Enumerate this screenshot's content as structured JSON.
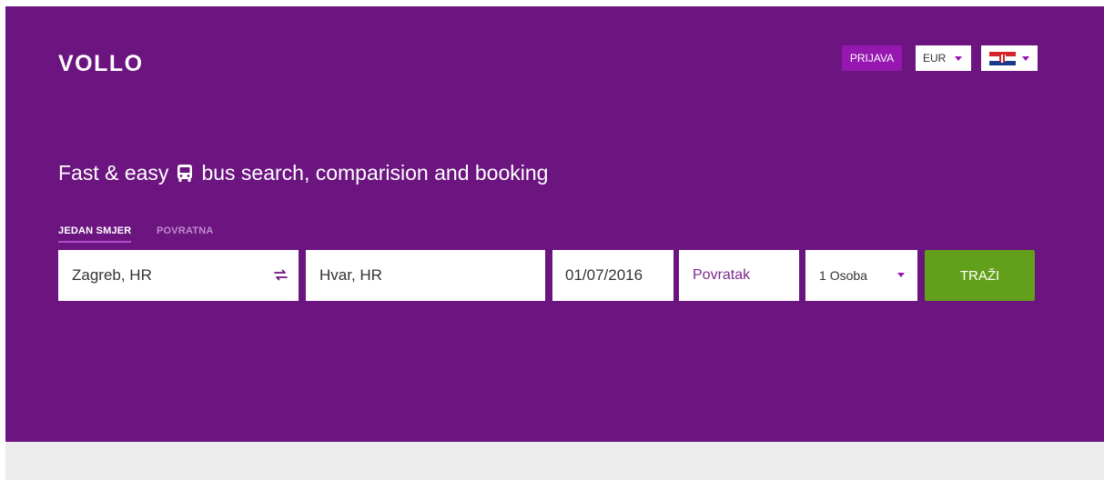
{
  "brand": {
    "logo": "VOLLO"
  },
  "header": {
    "login_label": "PRIJAVA",
    "currency": "EUR",
    "language_flag": "croatia-flag-icon"
  },
  "hero": {
    "tagline_before": "Fast & easy",
    "tagline_icon": "bus-icon",
    "tagline_after": "bus search, comparision and booking"
  },
  "tabs": [
    {
      "label": "JEDAN SMJER",
      "active": true
    },
    {
      "label": "POVRATNA",
      "active": false
    }
  ],
  "search": {
    "from": "Zagreb, HR",
    "to": "Hvar, HR",
    "date": "01/07/2016",
    "return_placeholder": "Povratak",
    "passengers_count": "1",
    "passengers_label": "Osoba",
    "submit_label": "TRAŽI"
  },
  "colors": {
    "hero_bg": "#6c1580",
    "accent": "#9517b0",
    "search_button": "#62a01b",
    "footer_bg": "#ececec"
  }
}
